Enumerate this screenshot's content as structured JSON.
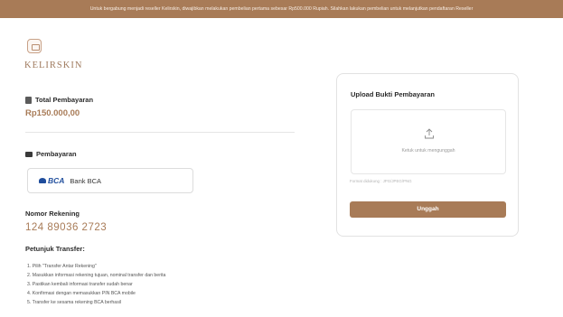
{
  "banner": {
    "text": "Untuk bergabung menjadi reseller Kelirskin, diwajibkan melakukan pembelian pertama sebesar Rp500.000 Rupiah. Silahkan lakukan pembelian untuk melanjutkan pendaftaran Reseller"
  },
  "brand": {
    "name": "KELIRSKIN",
    "logo_icon": "brand-logo-icon"
  },
  "total": {
    "label": "Total Pembayaran",
    "amount": "Rp150.000,00",
    "icon": "receipt-icon"
  },
  "payment": {
    "label": "Pembayaran",
    "icon": "card-icon",
    "bank_logo_text": "BCA",
    "bank_name": "Bank BCA"
  },
  "account": {
    "label": "Nomor Rekening",
    "number": "124 89036 2723"
  },
  "guide": {
    "title": "Petunjuk Transfer:",
    "steps": [
      "1. Pilih \"Transfer Antar Rekening\"",
      "2. Masukkan informasi rekening tujuan, nominal transfer dan berita",
      "3. Pastikan kembali informasi transfer sudah benar",
      "4. Konfirmasi dengan memasukkan PIN BCA mobile",
      "5. Transfer ke sesama rekening BCA berhasil"
    ]
  },
  "upload": {
    "title": "Upload Bukti Pembayaran",
    "drop_text": "Ketuk untuk mengunggah",
    "icon": "upload-icon",
    "format_text": "Format didukung : JPG/JPEG/PNG",
    "button_label": "Unggah"
  },
  "colors": {
    "accent": "#a87b57",
    "bca_blue": "#1f4d9c"
  }
}
